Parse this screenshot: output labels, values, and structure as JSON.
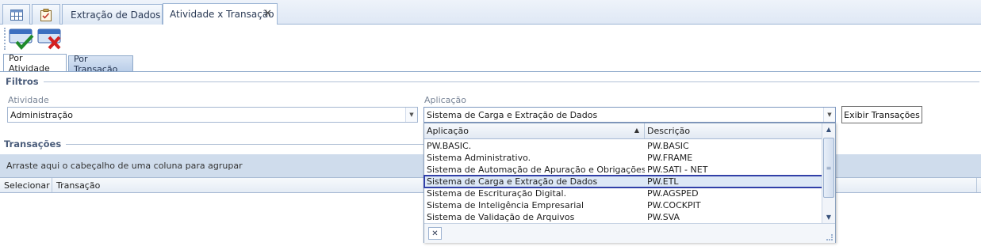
{
  "doc_tabs": {
    "tab1_icon": "grid-icon",
    "tab2_icon": "clipboard-icon",
    "tab3_label": "Extração de Dados",
    "tab4_label": "Atividade x Transação",
    "close_glyph": "✕"
  },
  "toolbar": {
    "confirm_icon": "confirm-check-icon",
    "cancel_icon": "cancel-x-icon"
  },
  "sub_tabs": {
    "por_atividade": "Por Atividade",
    "por_transacao": "Por Transação"
  },
  "filtros": {
    "title": "Filtros",
    "atividade_label": "Atividade",
    "atividade_value": "Administração",
    "aplicacao_label": "Aplicação",
    "aplicacao_value": "Sistema de Carga e Extração de Dados",
    "exibir_button": "Exibir Transações"
  },
  "transacoes": {
    "title": "Transações",
    "grouping_hint": "Arraste aqui o cabeçalho de uma coluna para agrupar",
    "columns": [
      "Selecionar",
      "Transação"
    ]
  },
  "dropdown": {
    "headers": [
      "Aplicação",
      "Descrição"
    ],
    "sort_glyph": "▲",
    "rows": [
      {
        "app": "PW.BASIC.",
        "desc": "PW.BASIC"
      },
      {
        "app": "Sistema Administrativo.",
        "desc": "PW.FRAME"
      },
      {
        "app": "Sistema de Automação de Apuração e Obrigações Fisc...",
        "desc": "PW.SATI - NET"
      },
      {
        "app": "Sistema de Carga e Extração de Dados",
        "desc": "PW.ETL"
      },
      {
        "app": "Sistema de Escrituração Digital.",
        "desc": "PW.AGSPED"
      },
      {
        "app": "Sistema de Inteligência Empresarial",
        "desc": "PW.COCKPIT"
      },
      {
        "app": "Sistema de Validação de Arquivos",
        "desc": "PW.SVA"
      }
    ],
    "selected_index": 3,
    "close_glyph": "✕",
    "selection_color": "#3140a8"
  },
  "colors": {
    "accent": "#3140a8",
    "tab_border": "#9eb6d5",
    "grouping_bar": "#cfdcec"
  }
}
